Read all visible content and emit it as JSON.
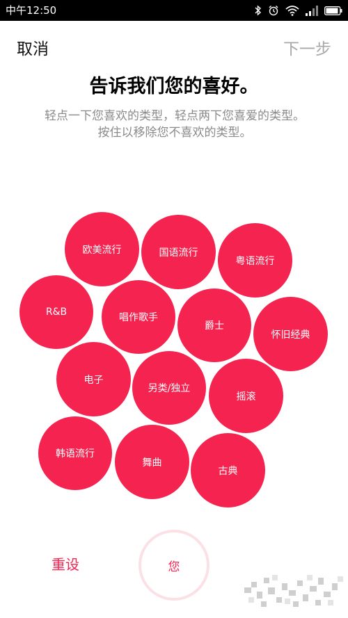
{
  "status_bar": {
    "time": "中午12:50",
    "icons": [
      "bluetooth-icon",
      "alarm-icon",
      "wifi-icon",
      "signal-icon",
      "battery-icon"
    ]
  },
  "nav": {
    "cancel_label": "取消",
    "next_label": "下一步"
  },
  "header": {
    "title": "告诉我们您的喜好。",
    "subtitle": "轻点一下您喜欢的类型，轻点两下您喜爱的类型。按住以移除您不喜欢的类型。"
  },
  "genres": [
    {
      "label": "欧美流行"
    },
    {
      "label": "国语流行"
    },
    {
      "label": "粤语流行"
    },
    {
      "label": "R&B"
    },
    {
      "label": "唱作歌手"
    },
    {
      "label": "爵士"
    },
    {
      "label": "怀旧经典"
    },
    {
      "label": "电子"
    },
    {
      "label": "另类/独立"
    },
    {
      "label": "摇滚"
    },
    {
      "label": "韩语流行"
    },
    {
      "label": "舞曲"
    },
    {
      "label": "古典"
    }
  ],
  "footer": {
    "reset_label": "重设",
    "you_label": "您"
  },
  "colors": {
    "accent": "#f5234f",
    "you_ring": "#fbe1e6",
    "next_disabled": "#a8a8a8",
    "subtitle": "#8a8a8a"
  }
}
